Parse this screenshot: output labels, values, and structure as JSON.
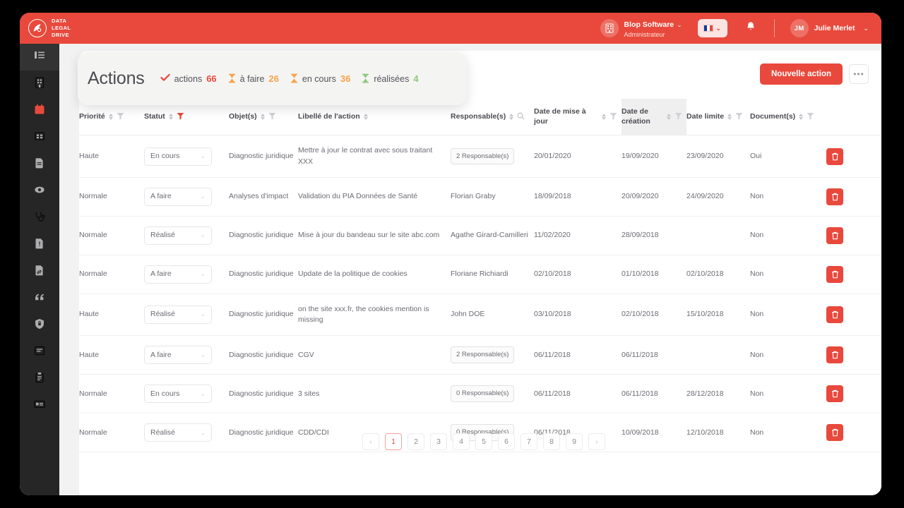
{
  "brand": {
    "logo_lines": [
      "DATA",
      "LEGAL",
      "DRIVE"
    ],
    "logo_glyph": "logo-icon",
    "accent_color": "#e8493c",
    "sidebar_color": "#262626"
  },
  "topbar": {
    "org_name": "Blop Software",
    "org_role": "Administrateur",
    "org_caret": "⌄",
    "language": "FR",
    "lang_caret": "⌄",
    "notification_icon": "bell-icon",
    "user_initials": "JM",
    "user_name": "Julie Merlet",
    "user_caret": "⌄"
  },
  "sidebar": {
    "items": [
      {
        "icon": "menu-list-icon",
        "active": true,
        "accent": false
      },
      {
        "icon": "building-icon",
        "active": false,
        "accent": false
      },
      {
        "icon": "calendar-icon",
        "active": false,
        "accent": true
      },
      {
        "icon": "grid-icon",
        "active": false,
        "accent": false
      },
      {
        "icon": "document-icon",
        "active": false,
        "accent": false
      },
      {
        "icon": "eye-icon",
        "active": false,
        "accent": false
      },
      {
        "icon": "stethoscope-icon",
        "active": false,
        "accent": false
      },
      {
        "icon": "file-alert-icon",
        "active": false,
        "accent": false
      },
      {
        "icon": "file-transfer-icon",
        "active": false,
        "accent": false
      },
      {
        "icon": "quote-icon",
        "active": false,
        "accent": false
      },
      {
        "icon": "lock-shield-icon",
        "active": false,
        "accent": false
      },
      {
        "icon": "book-icon",
        "active": false,
        "accent": false
      },
      {
        "icon": "clipboard-icon",
        "active": false,
        "accent": false
      },
      {
        "icon": "id-card-icon",
        "active": false,
        "accent": false
      }
    ]
  },
  "header_card": {
    "title": "Actions",
    "stats": [
      {
        "icon": "check-icon",
        "label": "actions",
        "value": "66",
        "color": "#e8493c"
      },
      {
        "icon": "hourglass-icon",
        "label": "à faire",
        "value": "26",
        "color": "#f5a24b"
      },
      {
        "icon": "hourglass-icon",
        "label": "en cours",
        "value": "36",
        "color": "#f5a24b"
      },
      {
        "icon": "hourglass-icon",
        "label": "réalisées",
        "value": "4",
        "color": "#8cc97a"
      }
    ]
  },
  "toolbar": {
    "new_action_label": "Nouvelle action",
    "more_label": "•••"
  },
  "table": {
    "columns": [
      {
        "key": "priorite",
        "label": "Priorité",
        "sortable": true,
        "filter": "inactive",
        "search": false,
        "highlight": false
      },
      {
        "key": "statut",
        "label": "Statut",
        "sortable": true,
        "filter": "active",
        "search": false,
        "highlight": false
      },
      {
        "key": "objets",
        "label": "Objet(s)",
        "sortable": true,
        "filter": "inactive",
        "search": false,
        "highlight": false
      },
      {
        "key": "libelle",
        "label": "Libellé de l'action",
        "sortable": true,
        "filter": "none",
        "search": false,
        "highlight": false
      },
      {
        "key": "resp",
        "label": "Responsable(s)",
        "sortable": true,
        "filter": "none",
        "search": true,
        "highlight": false
      },
      {
        "key": "maj",
        "label": "Date de mise à jour",
        "sortable": true,
        "filter": "inactive",
        "search": false,
        "highlight": false
      },
      {
        "key": "creation",
        "label": "Date de création",
        "sortable": true,
        "filter": "inactive",
        "search": false,
        "highlight": true
      },
      {
        "key": "limite",
        "label": "Date limite",
        "sortable": true,
        "filter": "inactive",
        "search": false,
        "highlight": false
      },
      {
        "key": "document",
        "label": "Document(s)",
        "sortable": true,
        "filter": "inactive",
        "search": false,
        "highlight": false
      },
      {
        "key": "actions",
        "label": "",
        "sortable": false,
        "filter": "none",
        "search": false,
        "highlight": false
      }
    ],
    "status_options": [
      "A faire",
      "En cours",
      "Réalisé"
    ],
    "rows": [
      {
        "priorite": "Haute",
        "statut": "En cours",
        "objets": "Diagnostic juridique",
        "libelle": "Mettre à jour le contrat avec sous traitant XXX",
        "resp": "2 Responsable(s)",
        "resp_chip": true,
        "maj": "20/01/2020",
        "creation": "19/09/2020",
        "limite": "23/09/2020",
        "document": "Oui",
        "delete_icon": "trash-icon"
      },
      {
        "priorite": "Normale",
        "statut": "A faire",
        "objets": "Analyses d'impact",
        "libelle": "Validation du PIA Données de Santé",
        "resp": "Florian Graby",
        "resp_chip": false,
        "maj": "18/09/2018",
        "creation": "20/09/2020",
        "limite": "24/09/2020",
        "document": "Non",
        "delete_icon": "trash-icon"
      },
      {
        "priorite": "Normale",
        "statut": "Réalisé",
        "objets": "Diagnostic juridique",
        "libelle": "Mise à jour du bandeau sur le site abc.com",
        "resp": "Agathe Girard-Camilleri",
        "resp_chip": false,
        "maj": "11/02/2020",
        "creation": "28/09/2018",
        "limite": "",
        "document": "Non",
        "delete_icon": "trash-icon"
      },
      {
        "priorite": "Normale",
        "statut": "A faire",
        "objets": "Diagnostic juridique",
        "libelle": "Update de la politique de cookies",
        "resp": "Floriane Richiardi",
        "resp_chip": false,
        "maj": "02/10/2018",
        "creation": "01/10/2018",
        "limite": "02/10/2018",
        "document": "Non",
        "delete_icon": "trash-icon"
      },
      {
        "priorite": "Haute",
        "statut": "Réalisé",
        "objets": "Diagnostic juridique",
        "libelle": "on the site xxx.fr, the cookies mention is missing",
        "resp": "John DOE",
        "resp_chip": false,
        "maj": "03/10/2018",
        "creation": "02/10/2018",
        "limite": "15/10/2018",
        "document": "Non",
        "delete_icon": "trash-icon"
      },
      {
        "priorite": "Haute",
        "statut": "A faire",
        "objets": "Diagnostic juridique",
        "libelle": "CGV",
        "resp": "2 Responsable(s)",
        "resp_chip": true,
        "maj": "06/11/2018",
        "creation": "06/11/2018",
        "limite": "",
        "document": "Non",
        "delete_icon": "trash-icon"
      },
      {
        "priorite": "Normale",
        "statut": "En cours",
        "objets": "Diagnostic juridique",
        "libelle": "3 sites",
        "resp": "0 Responsable(s)",
        "resp_chip": true,
        "maj": "06/11/2018",
        "creation": "06/11/2018",
        "limite": "28/12/2018",
        "document": "Non",
        "delete_icon": "trash-icon"
      },
      {
        "priorite": "Normale",
        "statut": "Réalisé",
        "objets": "Diagnostic juridique",
        "libelle": "CDD/CDI",
        "resp": "0 Responsable(s)",
        "resp_chip": true,
        "maj": "06/11/2018",
        "creation": "10/09/2018",
        "limite": "12/10/2018",
        "document": "Non",
        "delete_icon": "trash-icon"
      }
    ]
  },
  "pagination": {
    "prev": "‹",
    "next": "›",
    "pages": [
      "1",
      "2",
      "3",
      "4",
      "5",
      "6",
      "7",
      "8",
      "9"
    ],
    "current": "1"
  }
}
